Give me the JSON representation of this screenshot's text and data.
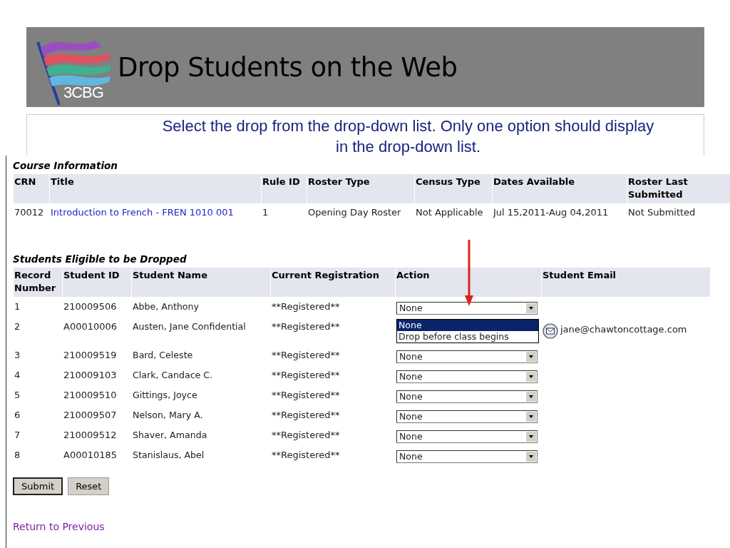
{
  "slide": {
    "logo_text": "3CBG",
    "title": "Drop Students on the Web",
    "instruction": "Select the drop from the drop-down list.  Only one option should display in the drop-down list."
  },
  "course": {
    "heading": "Course Information",
    "columns": [
      "CRN",
      "Title",
      "Rule ID",
      "Roster Type",
      "Census Type",
      "Dates Available",
      "Roster Last Submitted"
    ],
    "row": {
      "crn": "70012",
      "title": "Introduction to French - FREN 1010 001",
      "rule_id": "1",
      "roster_type": "Opening Day Roster",
      "census_type": "Not Applicable",
      "dates": "Jul 15,2011-Aug 04,2011",
      "last_submitted": "Not Submitted"
    }
  },
  "students": {
    "heading": "Students Eligible to be Dropped",
    "columns": [
      "Record Number",
      "Student ID",
      "Student Name",
      "Current Registration",
      "Action",
      "Student Email"
    ],
    "rows": [
      {
        "number": "1",
        "id": "210009506",
        "name": "Abbe, Anthony",
        "registration": "**Registered**",
        "action": {
          "open": false,
          "value": "None"
        }
      },
      {
        "number": "2",
        "id": "A00010006",
        "name": "Austen, Jane Confidential",
        "registration": "**Registered**",
        "action": {
          "open": true,
          "options": [
            {
              "label": "None",
              "selected": true
            },
            {
              "label": "Drop before class begins",
              "selected": false
            }
          ]
        },
        "email": "jane@chawtoncottage.com"
      },
      {
        "number": "3",
        "id": "210009519",
        "name": "Bard, Celeste",
        "registration": "**Registered**",
        "action": {
          "open": false,
          "value": "None"
        }
      },
      {
        "number": "4",
        "id": "210009103",
        "name": "Clark, Candace C.",
        "registration": "**Registered**",
        "action": {
          "open": false,
          "value": "None"
        }
      },
      {
        "number": "5",
        "id": "210009510",
        "name": "Gittings, Joyce",
        "registration": "**Registered**",
        "action": {
          "open": false,
          "value": "None"
        }
      },
      {
        "number": "6",
        "id": "210009507",
        "name": "Nelson, Mary A.",
        "registration": "**Registered**",
        "action": {
          "open": false,
          "value": "None"
        }
      },
      {
        "number": "7",
        "id": "210009512",
        "name": "Shaver, Amanda",
        "registration": "**Registered**",
        "action": {
          "open": false,
          "value": "None"
        }
      },
      {
        "number": "8",
        "id": "A00010185",
        "name": "Stanislaus, Abel",
        "registration": "**Registered**",
        "action": {
          "open": false,
          "value": "None"
        }
      }
    ]
  },
  "buttons": [
    "Submit",
    "Reset"
  ],
  "link": "Return to Previous"
}
